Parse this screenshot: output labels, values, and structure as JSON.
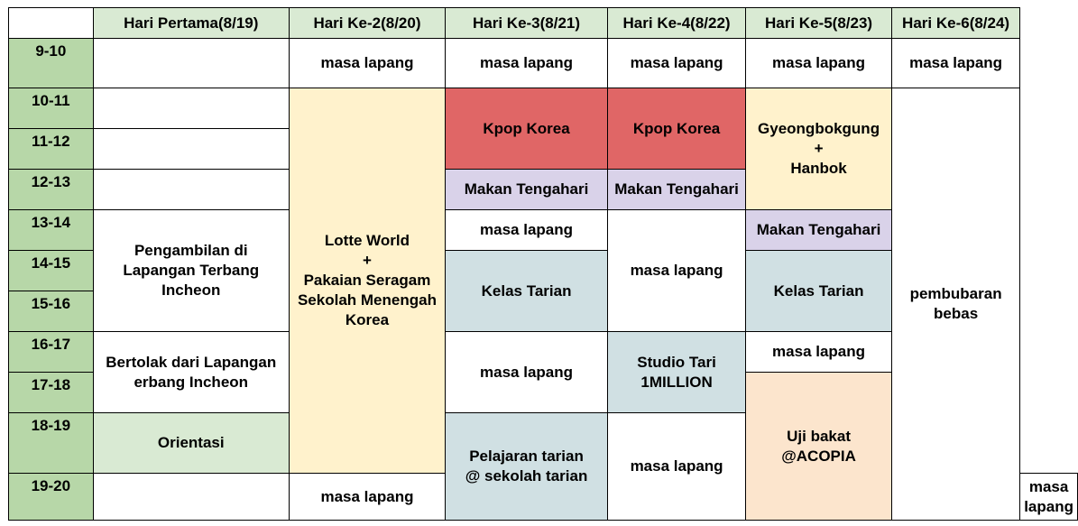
{
  "headers": {
    "corner": "",
    "day1": "Hari Pertama(8/19)",
    "day2": "Hari Ke-2(8/20)",
    "day3": "Hari Ke-3(8/21)",
    "day4": "Hari Ke-4(8/22)",
    "day5": "Hari Ke-5(8/23)",
    "day6": "Hari Ke-6(8/24)"
  },
  "times": [
    "9-10",
    "10-11",
    "11-12",
    "12-13",
    "13-14",
    "14-15",
    "15-16",
    "16-17",
    "17-18",
    "18-19",
    "19-20"
  ],
  "colors": {
    "time_column": "#b7d7a8",
    "header": "#d9ead3",
    "lotte_world": "#fff2cc",
    "kpop": "#e06666",
    "lunch": "#d9d2e9",
    "dance_class": "#d0e0e3",
    "orientation": "#d9ead3",
    "audition": "#fce5cd"
  },
  "day1": {
    "pickup": [
      "Pengambilan di",
      "Lapangan Terbang",
      "Incheon"
    ],
    "depart": [
      "Bertolak dari Lapangan",
      "erbang Incheon"
    ],
    "orientation": "Orientasi"
  },
  "day2": {
    "morning": "masa lapang",
    "lotte": [
      "Lotte World",
      "+",
      "Pakaian Seragam",
      "Sekolah Menengah",
      "Korea"
    ],
    "evening": "masa lapang"
  },
  "day3": {
    "morning": "masa lapang",
    "kpop": "Kpop Korea",
    "lunch": "Makan Tengahari",
    "free1": "masa lapang",
    "class": "Kelas Tarian",
    "free2": "masa lapang",
    "lesson": [
      "Pelajaran tarian",
      "@ sekolah tarian"
    ]
  },
  "day4": {
    "morning": "masa lapang",
    "kpop": "Kpop Korea",
    "lunch": "Makan Tengahari",
    "free1": "masa lapang",
    "studio": [
      "Studio Tari",
      "1MILLION"
    ],
    "free2": "masa lapang"
  },
  "day5": {
    "morning": "masa lapang",
    "palace": [
      "Gyeongbokgung",
      "+",
      "Hanbok"
    ],
    "lunch": "Makan Tengahari",
    "class": "Kelas Tarian",
    "free1": "masa lapang",
    "audition": [
      "Uji bakat",
      "@ACOPIA"
    ],
    "free2": "masa lapang"
  },
  "day6": {
    "morning": "masa lapang",
    "dismissal": [
      "pembubaran",
      "bebas"
    ]
  }
}
